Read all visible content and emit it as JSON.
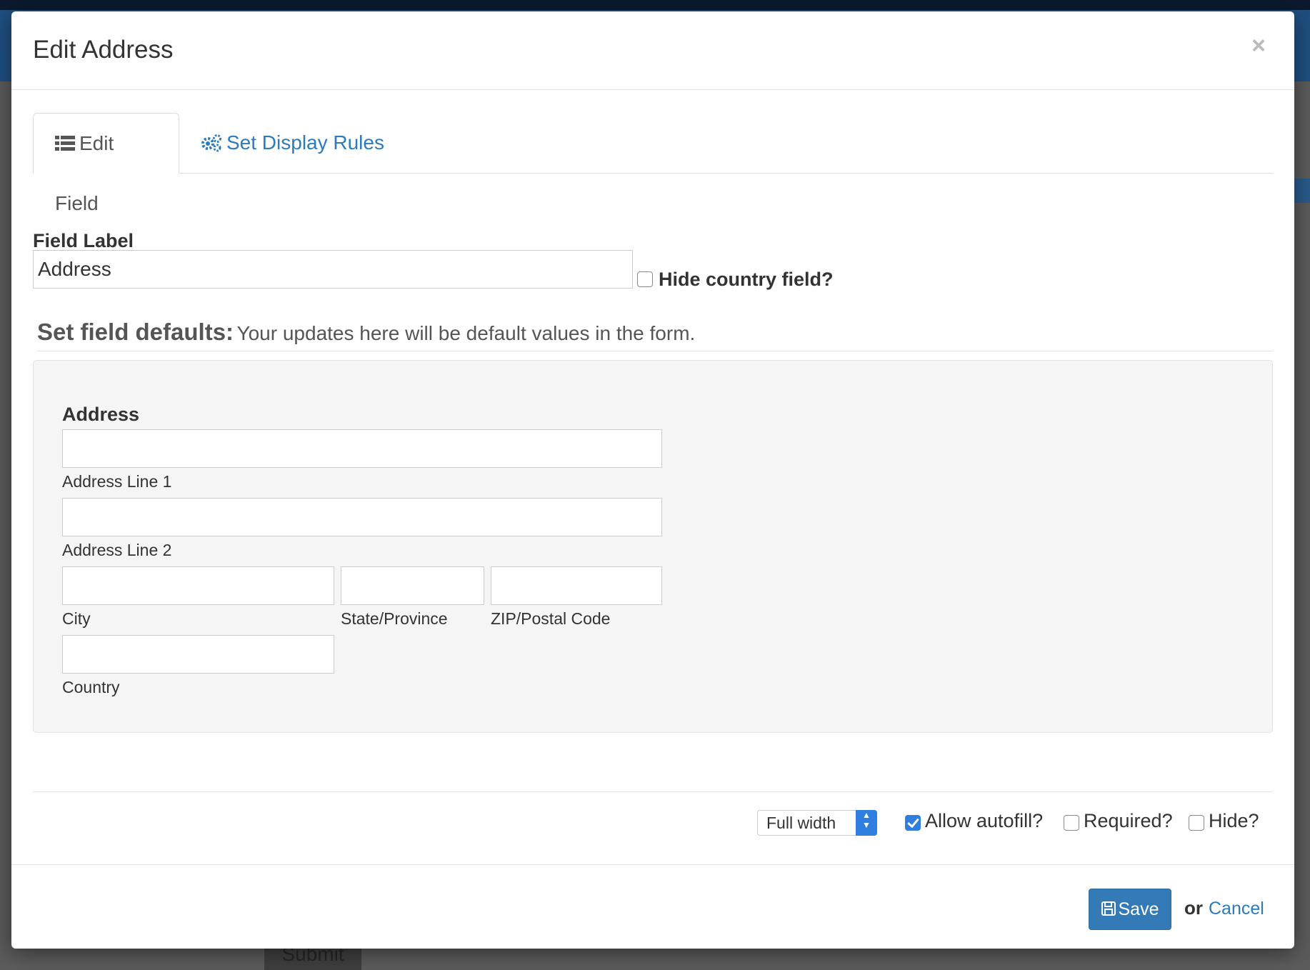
{
  "modal": {
    "title": "Edit Address",
    "close_symbol": "×"
  },
  "tabs": [
    {
      "label": "Edit Field",
      "icon": "list-icon",
      "active": true
    },
    {
      "label": "Set Display Rules",
      "icon": "cogs-icon",
      "active": false
    }
  ],
  "field_label": {
    "heading": "Field Label",
    "value": "Address",
    "hide_country_label": "Hide country field?",
    "hide_country_checked": false
  },
  "defaults": {
    "heading": "Set field defaults:",
    "description": "Your updates here will be default values in the form."
  },
  "address": {
    "title": "Address",
    "line1_label": "Address Line 1",
    "line2_label": "Address Line 2",
    "city_label": "City",
    "state_label": "State/Province",
    "zip_label": "ZIP/Postal Code",
    "country_label": "Country"
  },
  "options": {
    "width_select": "Full width",
    "allow_autofill_label": "Allow autofill?",
    "allow_autofill_checked": true,
    "required_label": "Required?",
    "required_checked": false,
    "hide_label": "Hide?",
    "hide_checked": false
  },
  "footer": {
    "save_label": "Save",
    "or_text": "or",
    "cancel_label": "Cancel"
  },
  "background": {
    "submit_label": "Submit"
  },
  "colors": {
    "accent": "#337ab7",
    "link": "#2b7bbd",
    "checkbox_checked": "#2f7fe0"
  }
}
